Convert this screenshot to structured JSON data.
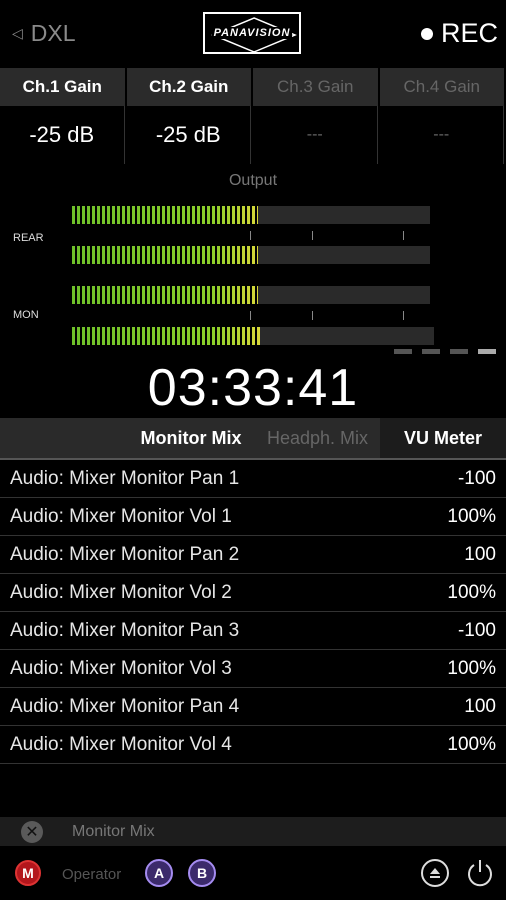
{
  "header": {
    "back_label": "DXL",
    "logo_text": "PANAVISION",
    "rec_label": "REC"
  },
  "gains": [
    {
      "label": "Ch.1 Gain",
      "value": "-25 dB",
      "enabled": true
    },
    {
      "label": "Ch.2 Gain",
      "value": "-25 dB",
      "enabled": true
    },
    {
      "label": "Ch.3 Gain",
      "value": "---",
      "enabled": false
    },
    {
      "label": "Ch.4 Gain",
      "value": "---",
      "enabled": false
    }
  ],
  "meters": {
    "output_label": "Output",
    "rear_label": "REAR",
    "mon_label": "MON",
    "levels": [
      0.52,
      0.52,
      0.52,
      0.52
    ]
  },
  "timecode": "03:33:41",
  "tabs": [
    {
      "label": "Monitor Mix",
      "state": "active"
    },
    {
      "label": "Headph. Mix",
      "state": "inactive"
    },
    {
      "label": "VU Meter",
      "state": "active"
    }
  ],
  "settings": [
    {
      "label": "Audio: Mixer Monitor Pan 1",
      "value": "-100"
    },
    {
      "label": "Audio: Mixer Monitor Vol 1",
      "value": "100%"
    },
    {
      "label": "Audio: Mixer Monitor Pan 2",
      "value": "100"
    },
    {
      "label": "Audio: Mixer Monitor Vol 2",
      "value": "100%"
    },
    {
      "label": "Audio: Mixer Monitor Pan 3",
      "value": "-100"
    },
    {
      "label": "Audio: Mixer Monitor Vol 3",
      "value": "100%"
    },
    {
      "label": "Audio: Mixer Monitor Pan 4",
      "value": "100"
    },
    {
      "label": "Audio: Mixer Monitor Vol 4",
      "value": "100%"
    }
  ],
  "mixbar": {
    "label": "Monitor Mix",
    "close_icon": "close-icon"
  },
  "footer": {
    "m_label": "M",
    "operator_label": "Operator",
    "a_label": "A",
    "b_label": "B"
  },
  "colors": {
    "meter_green": "#7bc72a",
    "rec_red": "#b3161c",
    "user_purple": "#a58cf0"
  }
}
